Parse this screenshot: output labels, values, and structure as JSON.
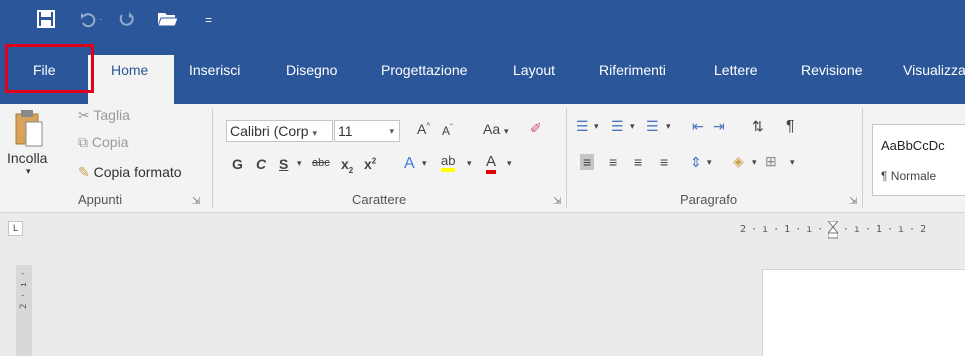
{
  "quick_access": {
    "save_icon": "save-icon",
    "undo_icon": "undo-icon",
    "redo_icon": "redo-icon",
    "open_icon": "folder-open-icon",
    "customize_icon": "chevron-down-icon"
  },
  "tabs": {
    "file": "File",
    "home": "Home",
    "insert": "Inserisci",
    "draw": "Disegno",
    "design": "Progettazione",
    "layout": "Layout",
    "references": "Riferimenti",
    "mailings": "Lettere",
    "review": "Revisione",
    "view": "Visualizza"
  },
  "clipboard": {
    "paste": "Incolla",
    "cut": "Taglia",
    "copy": "Copia",
    "format_painter": "Copia formato",
    "group_label": "Appunti"
  },
  "font": {
    "font_name": "Calibri (Corp",
    "font_size": "11",
    "grow": "A",
    "shrink": "A",
    "change_case": "Aa",
    "bold": "G",
    "italic": "C",
    "underline": "S",
    "strikethrough": "abc",
    "subscript": "x",
    "superscript": "x",
    "text_effects": "A",
    "highlight": "ab",
    "font_color": "A",
    "group_label": "Carattere"
  },
  "paragraph": {
    "pilcrow": "¶",
    "group_label": "Paragrafo"
  },
  "styles": {
    "preview": "AaBbCcDc",
    "normal": "¶ Normale"
  },
  "ruler": {
    "corner": "L",
    "horizontal": "2 · ı · 1 · ı · ",
    "horizontal_after": "· ı · 1 · ı · 2",
    "vertical": "2 · ı ·"
  },
  "colors": {
    "ribbon_blue": "#2b579a",
    "file_highlight": "#e0001a",
    "highlight_yellow": "#ffff00",
    "font_red": "#e00000"
  }
}
